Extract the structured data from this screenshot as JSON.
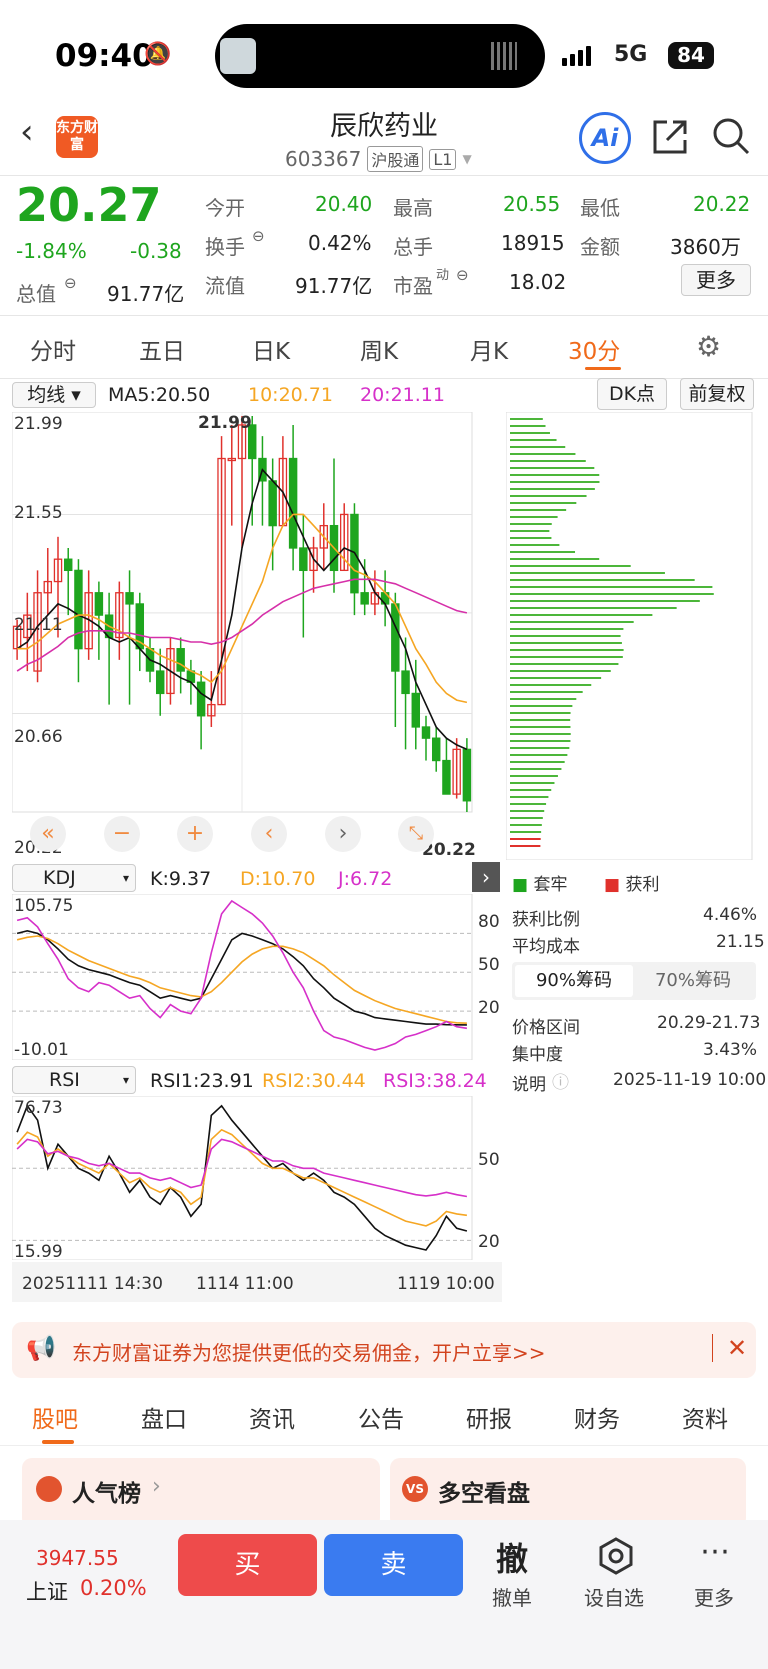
{
  "status": {
    "time": "09:40",
    "network": "5G",
    "battery": "84"
  },
  "header": {
    "title": "辰欣药业",
    "code": "603367",
    "tag1": "沪股通",
    "tag2": "L1",
    "logo_text": "东方财富",
    "ai_label": "Ai"
  },
  "quote": {
    "price": "20.27",
    "change_pct": "-1.84%",
    "change": "-0.38",
    "open_label": "今开",
    "open": "20.40",
    "high_label": "最高",
    "high": "20.55",
    "low_label": "最低",
    "low": "20.22",
    "turnover_label": "换手",
    "turnover": "0.42%",
    "volume_label": "总手",
    "volume": "18915",
    "amount_label": "金额",
    "amount": "3860万",
    "mktcap_label": "总值",
    "mktcap": "91.77亿",
    "float_label": "流值",
    "float": "91.77亿",
    "pe_label": "市盈",
    "pe_sup": "动",
    "pe": "18.02",
    "more": "更多"
  },
  "tabs": [
    "分时",
    "五日",
    "日K",
    "周K",
    "月K",
    "30分"
  ],
  "chart_header": {
    "indicator": "均线",
    "ma5": "MA5:20.50",
    "ma10": "10:20.71",
    "ma20": "20:21.11",
    "dk": "DK点",
    "fq": "前复权"
  },
  "price_axis": {
    "top": "21.99",
    "l2": "21.55",
    "l3": "21.11",
    "l4": "20.66",
    "bottom": "20.22",
    "hi_mark": "21.99",
    "lo_mark": "20.22"
  },
  "chips": {
    "legend_trap": "套牢",
    "legend_profit": "获利",
    "profit_ratio_label": "获利比例",
    "profit_ratio": "4.46%",
    "avg_cost_label": "平均成本",
    "avg_cost": "21.15",
    "tab90": "90%筹码",
    "tab70": "70%筹码",
    "range_label": "价格区间",
    "range": "20.29-21.73",
    "conc_label": "集中度",
    "conc": "3.43%",
    "note_label": "说明",
    "note": "2025-11-19 10:00"
  },
  "kdj": {
    "name": "KDJ",
    "k": "K:9.37",
    "d": "D:10.70",
    "j": "J:6.72",
    "top": "105.75",
    "bottom": "-10.01",
    "l80": "80",
    "l50": "50",
    "l20": "20"
  },
  "rsi": {
    "name": "RSI",
    "r1": "RSI1:23.91",
    "r2": "RSI2:30.44",
    "r3": "RSI3:38.24",
    "top": "76.73",
    "bottom": "15.99",
    "l50": "50",
    "l20": "20"
  },
  "time_axis": {
    "t1": "20251111 14:30",
    "t2": "1114 11:00",
    "t3": "1119 10:00"
  },
  "banner": {
    "text": "东方财富证券为您提供更低的交易佣金，开户立享>>"
  },
  "bottom_tabs": [
    "股吧",
    "盘口",
    "资讯",
    "公告",
    "研报",
    "财务",
    "资料"
  ],
  "cards": {
    "c1": "人气榜",
    "c2": "多空看盘"
  },
  "index": {
    "value": "3947.55",
    "name": "上证",
    "pct": "0.20%"
  },
  "actions": {
    "buy": "买",
    "sell": "卖",
    "cancel": "撤单",
    "watch": "设自选",
    "more": "更多",
    "cancel_glyph": "撤"
  },
  "chart_data": [
    {
      "type": "candlestick",
      "title": "",
      "ylim": [
        20.22,
        21.99
      ],
      "series": [
        {
          "name": "K",
          "values": [
            [
              20.95,
              21.05,
              20.9,
              21.08
            ],
            [
              21.0,
              21.1,
              20.85,
              21.2
            ],
            [
              20.85,
              21.2,
              20.8,
              21.3
            ],
            [
              21.2,
              21.25,
              21.1,
              21.4
            ],
            [
              21.25,
              21.35,
              21.0,
              21.45
            ],
            [
              21.35,
              21.3,
              21.1,
              21.4
            ],
            [
              21.3,
              20.95,
              20.8,
              21.35
            ],
            [
              20.95,
              21.2,
              20.9,
              21.3
            ],
            [
              21.2,
              21.1,
              20.9,
              21.25
            ],
            [
              21.1,
              21.0,
              20.7,
              21.2
            ],
            [
              21.0,
              21.2,
              20.9,
              21.25
            ],
            [
              21.2,
              21.15,
              20.7,
              21.3
            ],
            [
              21.15,
              20.95,
              20.85,
              21.2
            ],
            [
              20.95,
              20.85,
              20.8,
              21.0
            ],
            [
              20.85,
              20.75,
              20.65,
              20.95
            ],
            [
              20.75,
              20.95,
              20.7,
              21.0
            ],
            [
              20.95,
              20.85,
              20.75,
              21.0
            ],
            [
              20.85,
              20.8,
              20.7,
              20.9
            ],
            [
              20.8,
              20.65,
              20.5,
              20.85
            ],
            [
              20.65,
              20.7,
              20.6,
              20.85
            ],
            [
              20.7,
              21.8,
              20.7,
              21.9
            ],
            [
              21.8,
              21.8,
              21.5,
              21.95
            ],
            [
              21.8,
              21.95,
              21.4,
              21.99
            ],
            [
              21.95,
              21.8,
              21.5,
              21.99
            ],
            [
              21.8,
              21.7,
              21.5,
              21.9
            ],
            [
              21.7,
              21.5,
              21.3,
              21.8
            ],
            [
              21.5,
              21.8,
              21.5,
              21.9
            ],
            [
              21.8,
              21.4,
              21.3,
              21.95
            ],
            [
              21.4,
              21.3,
              21.0,
              21.55
            ],
            [
              21.3,
              21.4,
              21.2,
              21.45
            ],
            [
              21.4,
              21.5,
              21.3,
              21.6
            ],
            [
              21.5,
              21.3,
              21.2,
              21.8
            ],
            [
              21.3,
              21.55,
              21.3,
              21.6
            ],
            [
              21.55,
              21.2,
              21.1,
              21.6
            ],
            [
              21.2,
              21.15,
              21.1,
              21.35
            ],
            [
              21.15,
              21.2,
              21.1,
              21.3
            ],
            [
              21.2,
              21.15,
              21.05,
              21.3
            ],
            [
              21.15,
              20.85,
              20.6,
              21.2
            ],
            [
              20.85,
              20.75,
              20.5,
              21.0
            ],
            [
              20.75,
              20.6,
              20.5,
              20.9
            ],
            [
              20.6,
              20.55,
              20.45,
              20.65
            ],
            [
              20.55,
              20.45,
              20.4,
              20.6
            ],
            [
              20.45,
              20.3,
              20.3,
              20.55
            ],
            [
              20.3,
              20.5,
              20.28,
              20.55
            ],
            [
              20.5,
              20.27,
              20.22,
              20.55
            ]
          ]
        },
        {
          "name": "MA5",
          "values": [
            20.95,
            20.98,
            21.05,
            21.1,
            21.15,
            21.13,
            21.1,
            21.08,
            21.05,
            21.0,
            20.98,
            21.0,
            20.95,
            20.9,
            20.88,
            20.85,
            20.82,
            20.8,
            20.75,
            20.72,
            20.9,
            21.1,
            21.4,
            21.6,
            21.75,
            21.7,
            21.65,
            21.55,
            21.45,
            21.35,
            21.3,
            21.35,
            21.4,
            21.38,
            21.3,
            21.2,
            21.15,
            21.05,
            20.95,
            20.8,
            20.7,
            20.6,
            20.55,
            20.52,
            20.5
          ]
        },
        {
          "name": "MA10",
          "values": [
            20.95,
            20.95,
            20.98,
            21.02,
            21.06,
            21.08,
            21.1,
            21.1,
            21.08,
            21.05,
            21.03,
            21.0,
            20.98,
            20.95,
            20.92,
            20.9,
            20.88,
            20.85,
            20.83,
            20.8,
            20.85,
            20.95,
            21.05,
            21.15,
            21.25,
            21.4,
            21.5,
            21.55,
            21.55,
            21.5,
            21.45,
            21.4,
            21.35,
            21.3,
            21.28,
            21.25,
            21.2,
            21.15,
            21.05,
            20.95,
            20.88,
            20.8,
            20.75,
            20.72,
            20.71
          ]
        },
        {
          "name": "MA20",
          "values": [
            20.85,
            20.88,
            20.9,
            20.93,
            20.96,
            21.0,
            21.02,
            21.03,
            21.03,
            21.03,
            21.02,
            21.02,
            21.01,
            21.0,
            21.0,
            21.0,
            20.99,
            20.98,
            20.98,
            20.97,
            20.98,
            21.0,
            21.03,
            21.06,
            21.1,
            21.13,
            21.16,
            21.18,
            21.2,
            21.22,
            21.23,
            21.24,
            21.25,
            21.26,
            21.26,
            21.26,
            21.25,
            21.24,
            21.22,
            21.2,
            21.18,
            21.16,
            21.14,
            21.12,
            21.11
          ]
        }
      ]
    },
    {
      "type": "line",
      "title": "KDJ",
      "ylim": [
        -10.01,
        105.75
      ],
      "series": [
        {
          "name": "K",
          "values": [
            80,
            82,
            80,
            75,
            68,
            60,
            55,
            52,
            50,
            48,
            45,
            42,
            40,
            35,
            30,
            32,
            30,
            28,
            30,
            45,
            60,
            75,
            80,
            78,
            75,
            72,
            68,
            62,
            55,
            45,
            38,
            30,
            25,
            20,
            18,
            15,
            14,
            13,
            12,
            11,
            10,
            10,
            9.5,
            9.4,
            9.37
          ]
        },
        {
          "name": "D",
          "values": [
            75,
            77,
            78,
            76,
            72,
            67,
            63,
            59,
            56,
            53,
            50,
            47,
            45,
            42,
            38,
            36,
            34,
            32,
            31,
            35,
            42,
            50,
            58,
            64,
            68,
            70,
            70,
            68,
            65,
            60,
            55,
            48,
            42,
            36,
            32,
            28,
            25,
            22,
            20,
            18,
            16,
            14,
            12,
            11,
            10.7
          ]
        },
        {
          "name": "J",
          "values": [
            90,
            92,
            85,
            72,
            60,
            45,
            38,
            35,
            42,
            40,
            35,
            30,
            32,
            22,
            15,
            25,
            20,
            18,
            30,
            65,
            95,
            105,
            100,
            95,
            88,
            78,
            65,
            50,
            38,
            20,
            5,
            0,
            -2,
            -5,
            -8,
            -10,
            -8,
            -5,
            0,
            2,
            5,
            8,
            12,
            8,
            6.72
          ]
        }
      ]
    },
    {
      "type": "line",
      "title": "RSI",
      "ylim": [
        15.99,
        76.73
      ],
      "series": [
        {
          "name": "RSI1",
          "values": [
            65,
            76,
            70,
            50,
            60,
            55,
            50,
            48,
            45,
            55,
            48,
            40,
            45,
            38,
            35,
            42,
            38,
            30,
            35,
            72,
            76,
            70,
            65,
            60,
            55,
            50,
            52,
            48,
            45,
            48,
            45,
            40,
            38,
            35,
            30,
            25,
            22,
            20,
            18,
            17,
            16,
            22,
            30,
            25,
            23.91
          ]
        },
        {
          "name": "RSI2",
          "values": [
            60,
            65,
            63,
            55,
            58,
            55,
            52,
            50,
            48,
            52,
            48,
            44,
            46,
            42,
            40,
            42,
            40,
            35,
            38,
            62,
            66,
            64,
            60,
            56,
            52,
            50,
            50,
            48,
            46,
            46,
            44,
            42,
            40,
            38,
            36,
            34,
            32,
            30,
            28,
            27,
            26,
            28,
            32,
            31,
            30.44
          ]
        },
        {
          "name": "RSI3",
          "values": [
            58,
            62,
            61,
            56,
            57,
            55,
            54,
            52,
            51,
            52,
            50,
            48,
            48,
            46,
            45,
            46,
            44,
            42,
            43,
            58,
            62,
            61,
            59,
            57,
            55,
            53,
            53,
            51,
            50,
            50,
            48,
            47,
            46,
            45,
            44,
            43,
            42,
            41,
            40,
            39,
            38.5,
            39,
            40,
            39,
            38.24
          ]
        }
      ]
    }
  ]
}
